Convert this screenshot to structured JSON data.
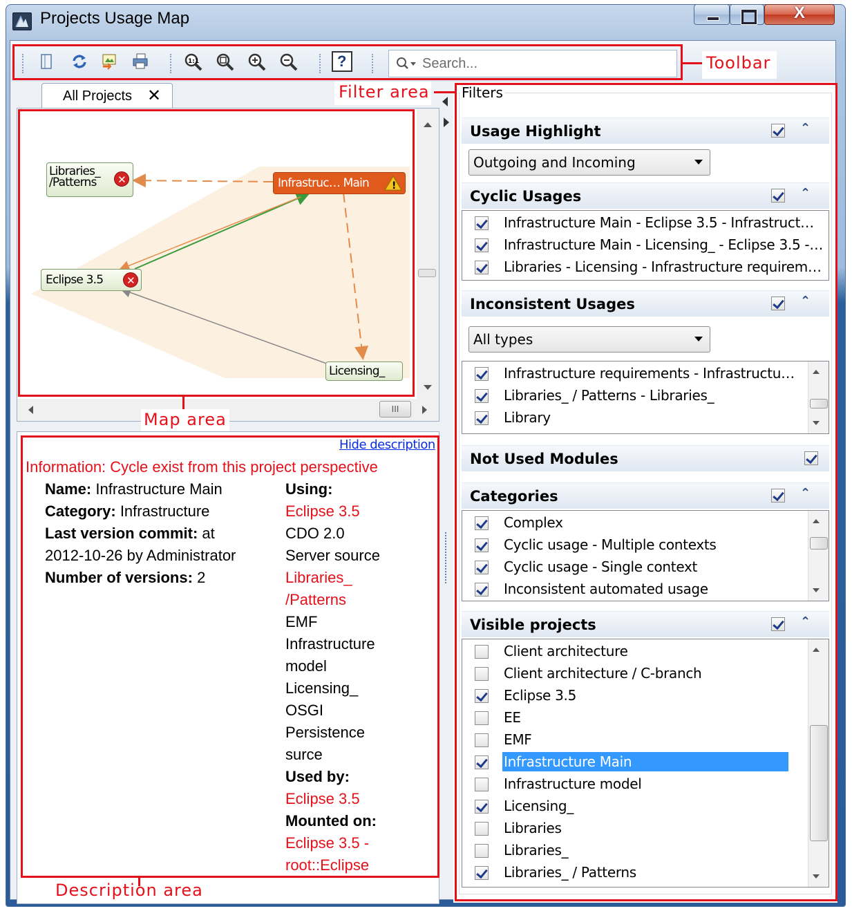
{
  "window": {
    "title": "Projects Usage Map",
    "close_glyph": "X"
  },
  "toolbar": {
    "icons": [
      "panel-toggle-icon",
      "refresh-icon",
      "export-image-icon",
      "print-icon",
      "zoom-reset-icon",
      "zoom-fit-icon",
      "zoom-in-icon",
      "zoom-out-icon",
      "help-icon"
    ],
    "help_glyph": "?",
    "search_placeholder": "Search..."
  },
  "callouts": {
    "toolbar": "Toolbar",
    "filter_area": "Filter area",
    "map_area": "Map area",
    "description_area": "Description area"
  },
  "tabs": [
    {
      "label": "All Projects",
      "close": "✕"
    }
  ],
  "map": {
    "nodes": {
      "libraries": [
        "Libraries_",
        "/Patterns"
      ],
      "infrastructure": "Infrastruc… Main",
      "eclipse": "Eclipse 3.5",
      "licensing": "Licensing_"
    },
    "colors": {
      "highlight_node": "#e05a1e",
      "outgoing_edge": "#e38b4a",
      "cyclic_edge": "#3c9b3c",
      "incoming_edge": "#888888",
      "error": "#d32222",
      "warning": "#f4c21a"
    },
    "scroll_thumb": "III"
  },
  "description": {
    "hide_link": "Hide description",
    "information": "Information: Cycle exist from this project perspective",
    "left": [
      {
        "label": "Name:",
        "value": "Infrastructure Main"
      },
      {
        "label": "Category:",
        "value": "Infrastructure"
      },
      {
        "label": "Last version commit:",
        "value": "at"
      },
      {
        "label": "",
        "value": "2012-10-26 by Administrator"
      },
      {
        "label": "Number of versions:",
        "value": "2"
      }
    ],
    "right": [
      {
        "text": "Using:",
        "style": "bold"
      },
      {
        "text": "Eclipse 3.5",
        "style": "red"
      },
      {
        "text": "CDO 2.0",
        "style": "normal"
      },
      {
        "text": "Server source",
        "style": "normal"
      },
      {
        "text": "Libraries_",
        "style": "red"
      },
      {
        "text": "/Patterns",
        "style": "red"
      },
      {
        "text": "EMF",
        "style": "normal"
      },
      {
        "text": "Infrastructure",
        "style": "normal"
      },
      {
        "text": "model",
        "style": "normal"
      },
      {
        "text": "Licensing_",
        "style": "normal"
      },
      {
        "text": "OSGI",
        "style": "normal"
      },
      {
        "text": "Persistence",
        "style": "normal"
      },
      {
        "text": "surce",
        "style": "normal"
      },
      {
        "text": "Used by:",
        "style": "bold"
      },
      {
        "text": "Eclipse 3.5",
        "style": "red"
      },
      {
        "text": "Mounted on:",
        "style": "bold"
      },
      {
        "text": "Eclipse 3.5 -",
        "style": "red"
      },
      {
        "text": "root::Eclipse",
        "style": "red"
      }
    ]
  },
  "filters": {
    "group_label": "Filters",
    "usage_highlight": {
      "title": "Usage Highlight",
      "enabled": true,
      "selected": "Outgoing and Incoming"
    },
    "cyclic_usages": {
      "title": "Cyclic Usages",
      "enabled": true,
      "items": [
        {
          "label": "Infrastructure Main - Eclipse 3.5 - Infrastruct…",
          "checked": true
        },
        {
          "label": "Infrastructure Main - Licensing_ - Eclipse 3.5 -…",
          "checked": true
        },
        {
          "label": "Libraries - Licensing - Infrastructure requirem…",
          "checked": true
        }
      ]
    },
    "inconsistent_usages": {
      "title": "Inconsistent Usages",
      "enabled": true,
      "selected": "All types",
      "items": [
        {
          "label": "Infrastructure requirements - Infrastructu…",
          "checked": true
        },
        {
          "label": "Libraries_ / Patterns - Libraries_",
          "checked": true
        },
        {
          "label": "Library",
          "checked": true
        }
      ]
    },
    "not_used_modules": {
      "title": "Not Used Modules",
      "enabled": true
    },
    "categories": {
      "title": "Categories",
      "enabled": true,
      "items": [
        {
          "label": "Complex",
          "checked": true
        },
        {
          "label": "Cyclic usage - Multiple contexts",
          "checked": true
        },
        {
          "label": "Cyclic usage - Single context",
          "checked": true
        },
        {
          "label": "Inconsistent automated usage",
          "checked": true
        }
      ]
    },
    "visible_projects": {
      "title": "Visible projects",
      "enabled": true,
      "selected_index": 5,
      "items": [
        {
          "label": "Client architecture",
          "checked": false
        },
        {
          "label": "Client architecture / C-branch",
          "checked": false
        },
        {
          "label": "Eclipse 3.5",
          "checked": true
        },
        {
          "label": "EE",
          "checked": false
        },
        {
          "label": "EMF",
          "checked": false
        },
        {
          "label": "Infrastructure Main",
          "checked": true
        },
        {
          "label": "Infrastructure model",
          "checked": false
        },
        {
          "label": "Licensing_",
          "checked": true
        },
        {
          "label": "Libraries",
          "checked": false
        },
        {
          "label": "Libraries_",
          "checked": false
        },
        {
          "label": "Libraries_ / Patterns",
          "checked": true
        }
      ]
    },
    "collapse_glyph": "⌃"
  }
}
